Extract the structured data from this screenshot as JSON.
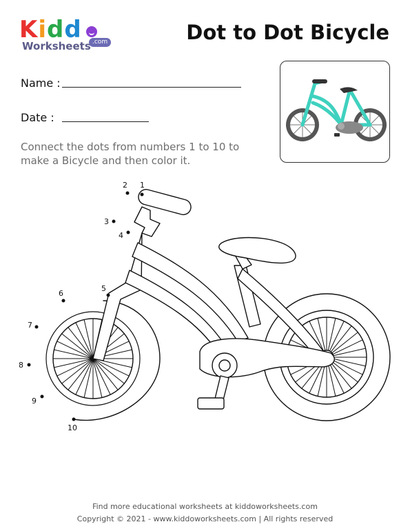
{
  "brand": {
    "name_letters": [
      "K",
      "i",
      "d",
      "d",
      "o"
    ],
    "line2": "Worksheets",
    "com": ".com"
  },
  "title": "Dot to Dot Bicycle",
  "form": {
    "name_label": "Name :",
    "date_label": "Date :"
  },
  "instructions": "Connect the dots from numbers 1 to 10 to make a Bicycle and then color it.",
  "dots": [
    "1",
    "2",
    "3",
    "4",
    "5",
    "6",
    "7",
    "8",
    "9",
    "10"
  ],
  "footer": {
    "line1": "Find more educational worksheets at kiddoworksheets.com",
    "line2": "Copyright © 2021 - www.kiddoworksheets.com  |  All rights reserved"
  },
  "colors": {
    "k": "#e8312f",
    "i": "#f39a1f",
    "d1": "#2aa84a",
    "d2": "#1e88d0",
    "o": "#8b3fd4",
    "bike_frame": "#3fd1bf",
    "tyre": "#555555"
  }
}
